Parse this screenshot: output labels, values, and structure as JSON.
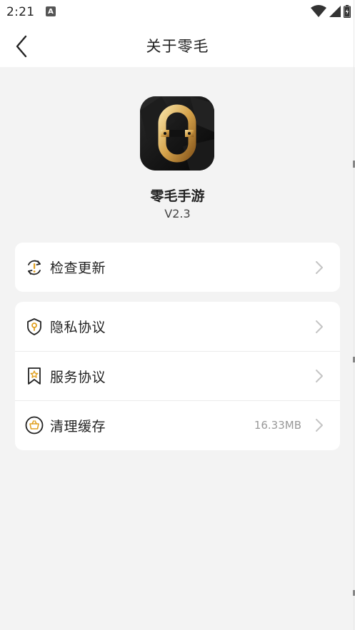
{
  "status_bar": {
    "time": "2:21",
    "notification_glyph": "A"
  },
  "header": {
    "title": "关于零毛"
  },
  "app": {
    "name": "零毛手游",
    "version": "V2.3"
  },
  "menu": {
    "check_update": {
      "label": "检查更新",
      "icon": "refresh-alert-icon"
    },
    "privacy": {
      "label": "隐私协议",
      "icon": "shield-icon"
    },
    "service": {
      "label": "服务协议",
      "icon": "bookmark-star-icon"
    },
    "clear_cache": {
      "label": "清理缓存",
      "value": "16.33MB",
      "icon": "basket-icon"
    }
  },
  "colors": {
    "accent": "#e0a020",
    "background": "#f3f3f3",
    "card": "#ffffff",
    "text": "#222222",
    "muted": "#999999",
    "chevron": "#c4c4c4"
  }
}
